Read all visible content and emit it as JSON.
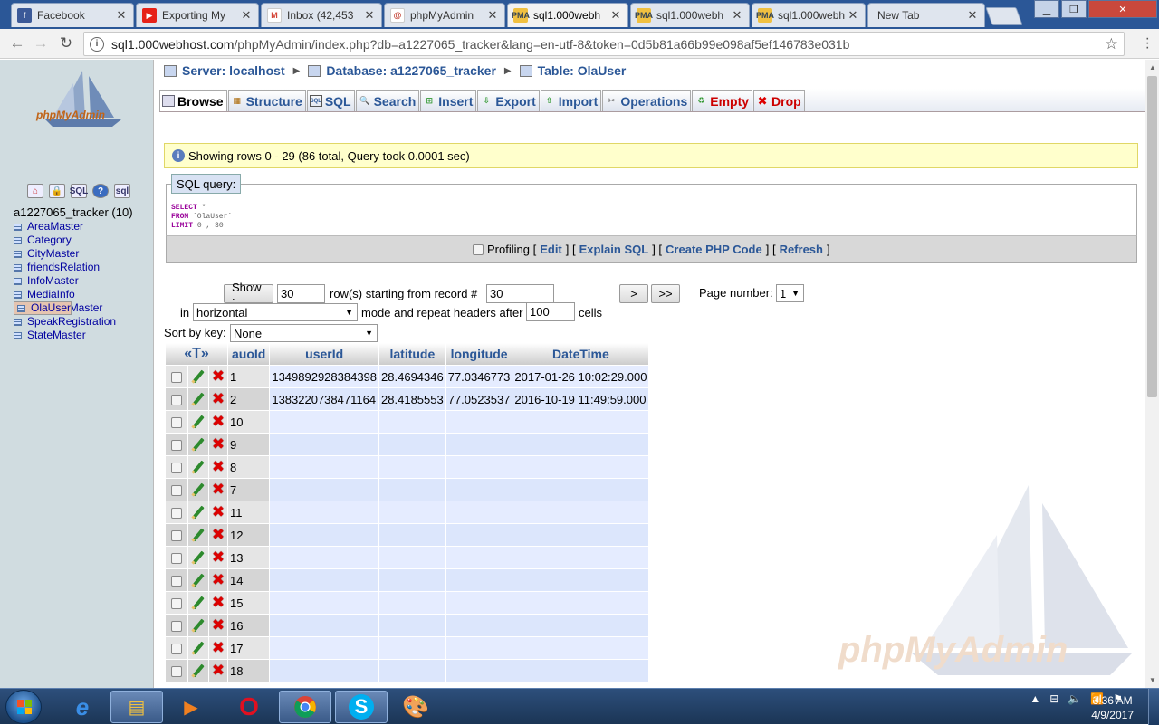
{
  "browser": {
    "tabs": [
      {
        "title": "Facebook",
        "icon": "facebook-icon",
        "color": "#3b5998",
        "active": false
      },
      {
        "title": "Exporting My",
        "icon": "youtube-icon",
        "color": "#e62117",
        "active": false
      },
      {
        "title": "Inbox (42,453",
        "icon": "gmail-icon",
        "color": "#d44638",
        "active": false
      },
      {
        "title": "phpMyAdmin",
        "icon": "000webhost-icon",
        "color": "#c0392b",
        "active": false
      },
      {
        "title": "sql1.000webh",
        "icon": "pma-icon",
        "color": "#e0a020",
        "active": true
      },
      {
        "title": "sql1.000webh",
        "icon": "pma-icon",
        "color": "#e0a020",
        "active": false
      },
      {
        "title": "sql1.000webh",
        "icon": "pma-icon",
        "color": "#e0a020",
        "active": false
      },
      {
        "title": "New Tab",
        "icon": "",
        "color": "",
        "active": false
      }
    ],
    "url_host": "sql1.000webhost.com",
    "url_rest": "/phpMyAdmin/index.php?db=a1227065_tracker&lang=en-utf-8&token=0d5b81a66b99e098af5ef146783e031b"
  },
  "sidebar": {
    "db_title": "a1227065_tracker (10)",
    "tables": [
      "AreaMaster",
      "Category",
      "CityMaster",
      "friendsRelation",
      "InfoMaster",
      "MediaInfo",
      "OlaUser",
      "ReporterMaster",
      "SpeakRegistration",
      "StateMaster"
    ],
    "selected": "OlaUser",
    "icons": [
      "home-icon",
      "lock-icon",
      "sql-icon",
      "help-icon",
      "query-window-icon"
    ],
    "icon_labels": {
      "sql": "SQL",
      "help": "?",
      "query": "sql"
    }
  },
  "breadcrumb": {
    "server": "Server: localhost",
    "database": "Database: a1227065_tracker",
    "table": "Table: OlaUser"
  },
  "tabs": {
    "browse": "Browse",
    "structure": "Structure",
    "sql": "SQL",
    "search": "Search",
    "insert": "Insert",
    "export": "Export",
    "import": "Import",
    "operations": "Operations",
    "empty": "Empty",
    "drop": "Drop"
  },
  "notice": "Showing rows 0 - 29 (86 total, Query took 0.0001 sec)",
  "sql": {
    "legend": "SQL query:",
    "line1_kw": "SELECT",
    "line1_rest": " *",
    "line2_kw": "FROM",
    "line2_rest": " `OlaUser`",
    "line3_kw": "LIMIT",
    "line3_rest": " 0 , 30",
    "profiling": "Profiling",
    "edit": "Edit",
    "explain": "Explain SQL",
    "php": "Create PHP Code",
    "refresh": "Refresh"
  },
  "nav": {
    "show_btn": "Show :",
    "rows_value": "30",
    "rows_label": "row(s) starting from record #",
    "start_value": "30",
    "next_btn": ">",
    "last_btn": ">>",
    "page_label": "Page number:",
    "page_value": "1",
    "in_label": "in",
    "mode_value": "horizontal",
    "mode_label": "mode and repeat headers after",
    "repeat_value": "100",
    "cells_label": "cells",
    "sort_label": "Sort by key:",
    "sort_value": "None"
  },
  "table": {
    "toggle_glyph": "T",
    "columns": [
      "auoId",
      "userId",
      "latitude",
      "longitude",
      "DateTime"
    ],
    "rows": [
      [
        "1",
        "1349892928384398",
        "28.4694346",
        "77.0346773",
        "2017-01-26 10:02:29.000"
      ],
      [
        "2",
        "1383220738471164",
        "28.4185553",
        "77.0523537",
        "2016-10-19 11:49:59.000"
      ],
      [
        "10",
        "",
        "",
        "",
        ""
      ],
      [
        "9",
        "",
        "",
        "",
        ""
      ],
      [
        "8",
        "",
        "",
        "",
        ""
      ],
      [
        "7",
        "",
        "",
        "",
        ""
      ],
      [
        "11",
        "",
        "",
        "",
        ""
      ],
      [
        "12",
        "",
        "",
        "",
        ""
      ],
      [
        "13",
        "",
        "",
        "",
        ""
      ],
      [
        "14",
        "",
        "",
        "",
        ""
      ],
      [
        "15",
        "",
        "",
        "",
        ""
      ],
      [
        "16",
        "",
        "",
        "",
        ""
      ],
      [
        "17",
        "",
        "",
        "",
        ""
      ],
      [
        "18",
        "",
        "",
        "",
        ""
      ]
    ]
  },
  "watermark": "phpMyAdmin",
  "logo_text": "phpMyAdmin",
  "taskbar": {
    "time": "3:36 AM",
    "date": "4/9/2017",
    "apps": [
      "internet-explorer-icon",
      "file-explorer-icon",
      "media-player-icon",
      "opera-icon",
      "chrome-icon",
      "skype-icon",
      "paint-icon"
    ]
  }
}
